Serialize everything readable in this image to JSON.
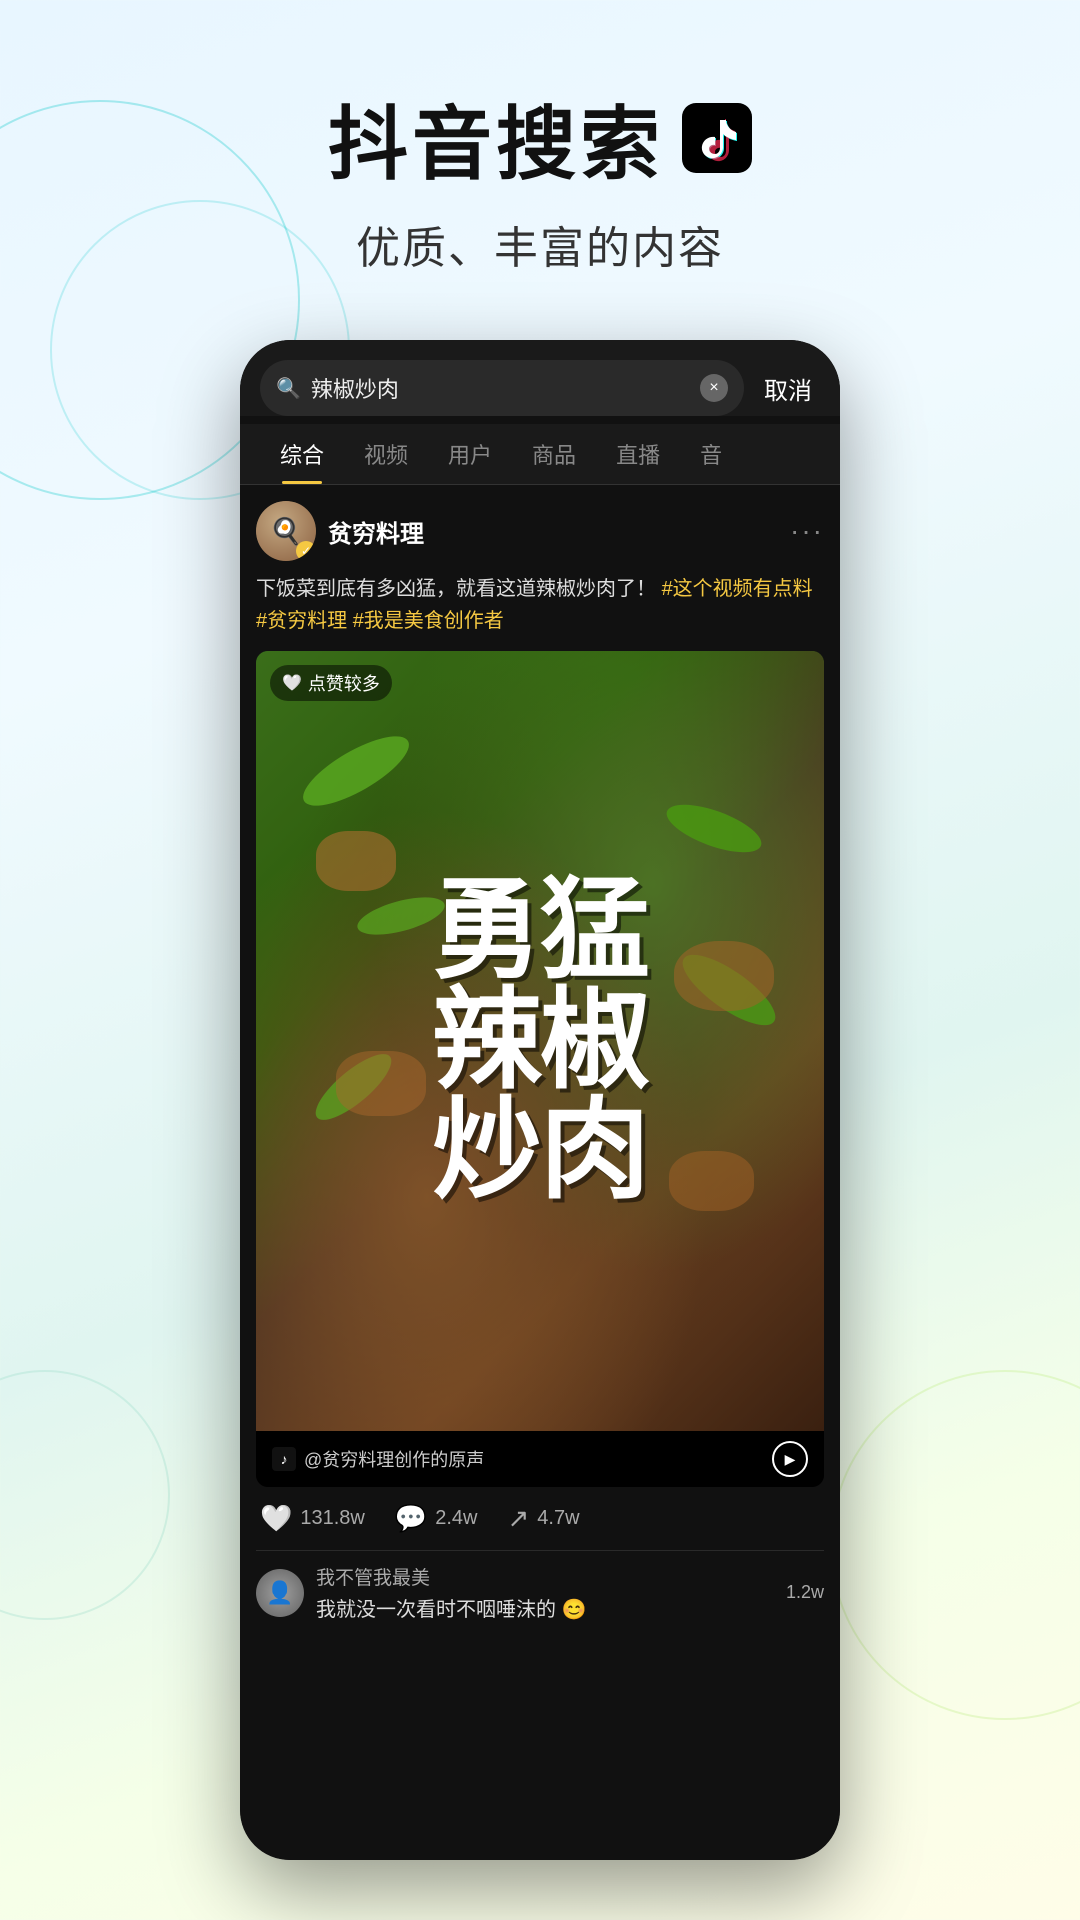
{
  "header": {
    "main_title": "抖音搜索",
    "subtitle": "优质、丰富的内容"
  },
  "search": {
    "query": "辣椒炒肉",
    "cancel_label": "取消",
    "clear_icon": "×"
  },
  "tabs": [
    {
      "label": "综合",
      "active": true
    },
    {
      "label": "视频",
      "active": false
    },
    {
      "label": "用户",
      "active": false
    },
    {
      "label": "商品",
      "active": false
    },
    {
      "label": "直播",
      "active": false
    },
    {
      "label": "音",
      "active": false
    }
  ],
  "post": {
    "username": "贫穷料理",
    "verified": true,
    "description": "下饭菜到底有多凶猛，就看这道辣椒炒肉了！",
    "hashtags": [
      "#这个视频有点料",
      "#贫穷料理",
      "#我是美食创作者"
    ],
    "like_badge": "点赞较多",
    "video_title": "勇\n猛\n辣\n椒\n炒\n肉",
    "sound_text": "@贫穷料理创作的原声",
    "more_icon": "···"
  },
  "interactions": {
    "likes": "131.8w",
    "comments": "2.4w",
    "shares": "4.7w"
  },
  "comment": {
    "username": "我不管我最美",
    "text": "我就没一次看时不咽唾沫的 😊",
    "likes": "1.2w"
  },
  "colors": {
    "accent": "#f5c842",
    "bg_start": "#e8f6ff",
    "bg_end": "#fffde8",
    "dark_bg": "#111111"
  }
}
